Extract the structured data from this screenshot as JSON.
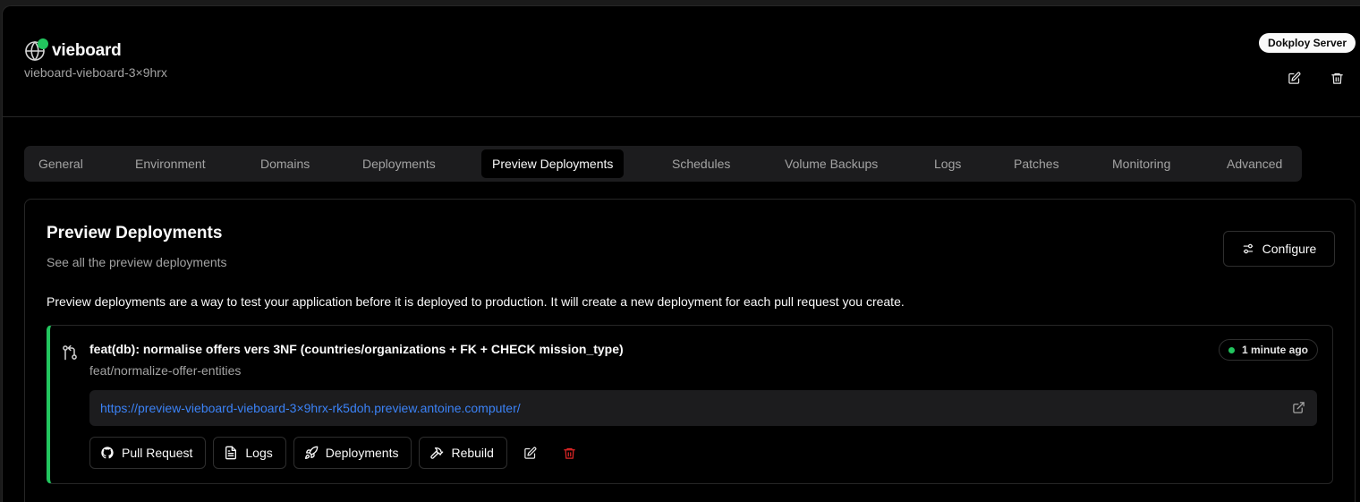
{
  "header": {
    "app_name": "vieboard",
    "app_slug": "vieboard-vieboard-3×9hrx",
    "server_badge": "Dokploy Server",
    "status_color": "#22c55e"
  },
  "tabs": [
    {
      "label": "General"
    },
    {
      "label": "Environment"
    },
    {
      "label": "Domains"
    },
    {
      "label": "Deployments"
    },
    {
      "label": "Preview Deployments",
      "active": true
    },
    {
      "label": "Schedules"
    },
    {
      "label": "Volume Backups"
    },
    {
      "label": "Logs"
    },
    {
      "label": "Patches"
    },
    {
      "label": "Monitoring"
    },
    {
      "label": "Advanced"
    }
  ],
  "card": {
    "title": "Preview Deployments",
    "subtitle": "See all the preview deployments",
    "configure_label": "Configure",
    "description": "Preview deployments are a way to test your application before it is deployed to production. It will create a new deployment for each pull request you create."
  },
  "preview": {
    "title": "feat(db): normalise offers vers 3NF (countries/organizations + FK + CHECK mission_type)",
    "branch": "feat/normalize-offer-entities",
    "time": "1 minute ago",
    "url": "https://preview-vieboard-vieboard-3×9hrx-rk5doh.preview.antoine.computer/",
    "actions": {
      "pull_request": "Pull Request",
      "logs": "Logs",
      "deployments": "Deployments",
      "rebuild": "Rebuild"
    },
    "accent_color": "#22c55e",
    "delete_color": "#dc2626",
    "link_color": "#3b82f6"
  }
}
